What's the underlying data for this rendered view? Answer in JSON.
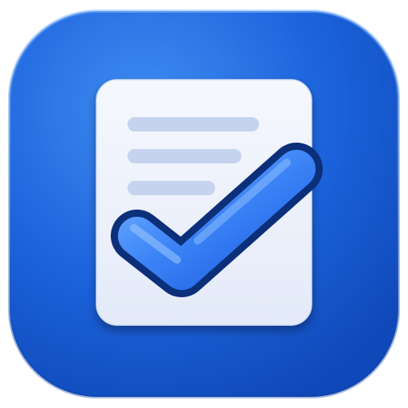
{
  "icon": {
    "name": "document-checklist-app-icon",
    "glyphs": [
      "rounded-square-background",
      "document-icon",
      "text-lines",
      "checkmark-icon"
    ]
  },
  "colors": {
    "background_light": "#3f8cf2",
    "background_mid": "#1c63dc",
    "background_dark": "#0f48b8",
    "document": "#eef3fc",
    "document_shadow": "#b7c6e6",
    "text_line": "#c5d3ee",
    "check_fill_light": "#5aa2ff",
    "check_fill_dark": "#1e5fe0",
    "check_outline": "#0c2f7a"
  },
  "document": {
    "line_count": 3
  }
}
